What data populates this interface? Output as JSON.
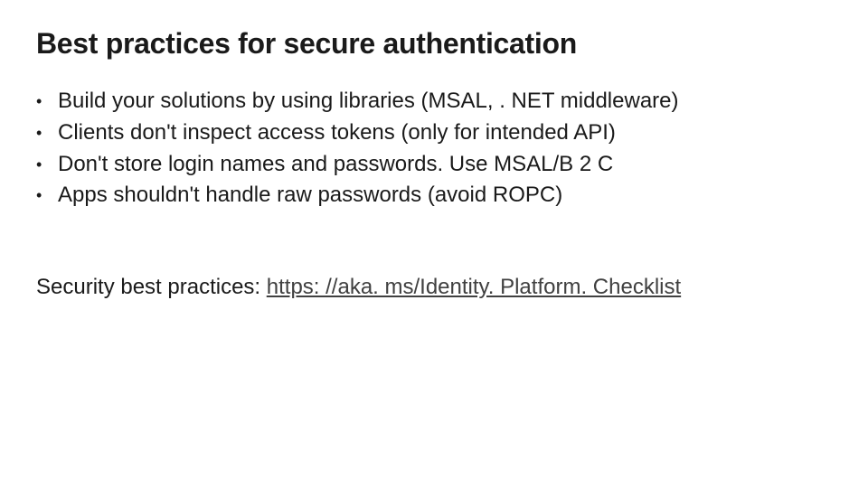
{
  "title": "Best practices for secure authentication",
  "bullets": [
    "Build your solutions by using libraries (MSAL, . NET middleware)",
    "Clients don't inspect access tokens (only for intended API)",
    "Don't store login names and passwords. Use MSAL/B 2 C",
    "Apps shouldn't handle raw passwords (avoid ROPC)"
  ],
  "footer": {
    "prefix": "Security best practices: ",
    "link_text": "https: //aka. ms/Identity. Platform. Checklist"
  }
}
